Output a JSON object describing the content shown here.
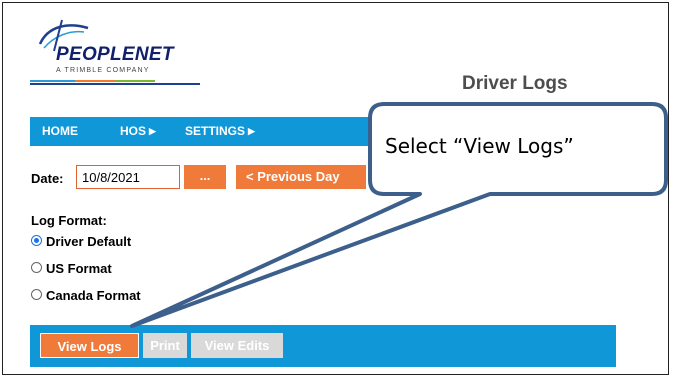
{
  "logo": {
    "wordmark": "PEOPLENET",
    "subtitle": "A TRIMBLE COMPANY",
    "colors": [
      "#2a9bd6",
      "#f07b2c",
      "#7ab733",
      "#1f3f8f"
    ]
  },
  "page_title": "Driver Logs",
  "nav": {
    "home": "HOME",
    "hos": "HOS",
    "settings": "SETTINGS",
    "arrow": "▶"
  },
  "date": {
    "label": "Date:",
    "value": "10/8/2021",
    "picker_label": "...",
    "previous_day_label": "< Previous Day"
  },
  "log_format": {
    "label": "Log Format:",
    "options": [
      {
        "label": "Driver Default",
        "selected": true
      },
      {
        "label": "US Format",
        "selected": false
      },
      {
        "label": "Canada Format",
        "selected": false
      }
    ]
  },
  "actions": {
    "view_logs": "View Logs",
    "print": "Print",
    "view_edits": "View Edits"
  },
  "callout": {
    "text": "Select “View Logs”"
  },
  "colors": {
    "nav_blue": "#0f97d8",
    "button_orange": "#ef7a3a",
    "disabled_gray": "#d9d9d9",
    "callout_border": "#3c5f8c"
  }
}
